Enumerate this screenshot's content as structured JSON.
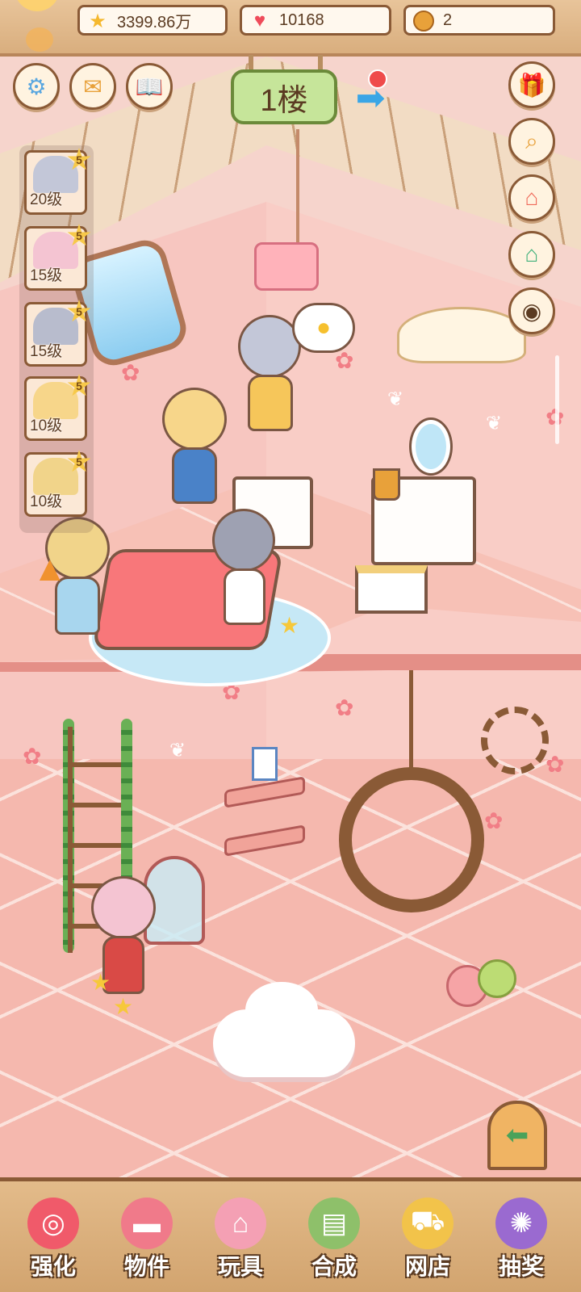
{
  "currencies": {
    "gold": "3399.86万",
    "hearts": "10168",
    "coins": "2"
  },
  "floor_sign": "1楼",
  "characters": [
    {
      "level": "20级",
      "stars": "5"
    },
    {
      "level": "15级",
      "stars": "5"
    },
    {
      "level": "15级",
      "stars": "5"
    },
    {
      "level": "10级",
      "stars": "5"
    },
    {
      "level": "10级",
      "stars": "5"
    }
  ],
  "bottom_nav": [
    {
      "label": "强化",
      "icon": "lollipop-icon",
      "color": "#f05a6a"
    },
    {
      "label": "物件",
      "icon": "piano-icon",
      "color": "#f07a8a"
    },
    {
      "label": "玩具",
      "icon": "toy-house-icon",
      "color": "#f4a0b4"
    },
    {
      "label": "合成",
      "icon": "cards-icon",
      "color": "#8ec06a"
    },
    {
      "label": "网店",
      "icon": "shop-cart-icon",
      "color": "#f2c34a"
    },
    {
      "label": "抽奖",
      "icon": "lottery-wheel-icon",
      "color": "#9a6ad0"
    }
  ],
  "colors": {
    "wall": "#f9cdc6",
    "floor": "#f5b8ae",
    "wood": "#8a5a36",
    "sign_green": "#c6e59a"
  }
}
